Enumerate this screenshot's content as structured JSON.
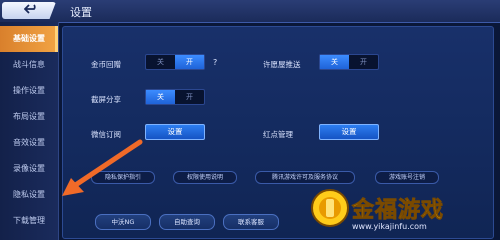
{
  "header": {
    "title": "设置"
  },
  "sidebar": {
    "items": [
      {
        "label": "基础设置"
      },
      {
        "label": "战斗信息"
      },
      {
        "label": "操作设置"
      },
      {
        "label": "布局设置"
      },
      {
        "label": "音效设置"
      },
      {
        "label": "录像设置"
      },
      {
        "label": "隐私设置"
      },
      {
        "label": "下载管理"
      }
    ]
  },
  "settings": {
    "coin_gift": {
      "label": "金币回赠",
      "off": "关",
      "on": "开",
      "help": "?"
    },
    "friend_push": {
      "label": "许愿屋推送",
      "off": "关",
      "on": "开"
    },
    "screenshot_share": {
      "label": "截屏分享",
      "off": "关",
      "on": "开"
    },
    "wechat_sub": {
      "label": "微信订阅",
      "button": "设置"
    },
    "redpoint": {
      "label": "红点管理",
      "button": "设置"
    }
  },
  "links": {
    "privacy": "隐私保护指引",
    "permission": "权限使用说明",
    "license": "腾讯游戏许可及服务协议",
    "account_cancel": "游戏账号注销"
  },
  "bottom": {
    "credit": "中沃NG",
    "self_query": "自助查询",
    "contact": "联系客服"
  },
  "watermark": {
    "name": "金福游戏",
    "url": "www.yikajinfu.com"
  },
  "colors": {
    "accent_orange": "#f2a444",
    "toggle_on": "#2f7cf6",
    "arrow": "#f06a28"
  }
}
